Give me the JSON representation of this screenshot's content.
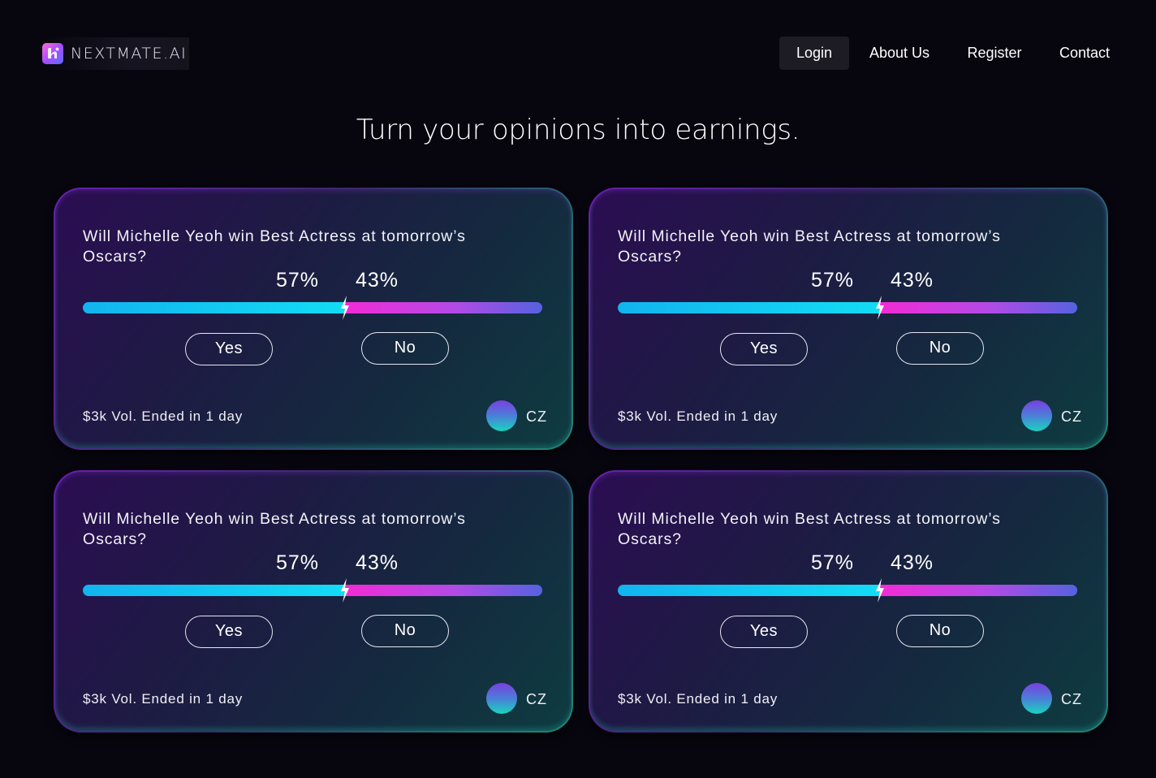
{
  "brand": {
    "name": "NEXTMATE.AI",
    "logo_icon": "nextmate-logo-icon"
  },
  "nav": {
    "login": "Login",
    "about": "About Us",
    "register": "Register",
    "contact": "Contact"
  },
  "headline": "Turn your opinions into earnings.",
  "colors": {
    "background": "#07060f",
    "yes_bar": "#13dcf4",
    "no_bar": "#f22bd6",
    "card_border_start": "#6a1fb0",
    "card_border_end": "#1c8a78"
  },
  "markets": [
    {
      "question": "Will Michelle Yeoh win Best Actress at tomorrow’s Oscars?",
      "yes_pct": 57,
      "no_pct": 43,
      "yes_label": "57%",
      "no_label": "43%",
      "yes_button": "Yes",
      "no_button": "No",
      "meta": "$3k Vol. Ended in 1 day",
      "creator": "CZ"
    },
    {
      "question": "Will Michelle Yeoh win Best Actress at tomorrow’s Oscars?",
      "yes_pct": 57,
      "no_pct": 43,
      "yes_label": "57%",
      "no_label": "43%",
      "yes_button": "Yes",
      "no_button": "No",
      "meta": "$3k Vol. Ended in 1 day",
      "creator": "CZ"
    },
    {
      "question": "Will Michelle Yeoh win Best Actress at tomorrow’s Oscars?",
      "yes_pct": 57,
      "no_pct": 43,
      "yes_label": "57%",
      "no_label": "43%",
      "yes_button": "Yes",
      "no_button": "No",
      "meta": "$3k Vol. Ended in 1 day",
      "creator": "CZ"
    },
    {
      "question": "Will Michelle Yeoh win Best Actress at tomorrow’s Oscars?",
      "yes_pct": 57,
      "no_pct": 43,
      "yes_label": "57%",
      "no_label": "43%",
      "yes_button": "Yes",
      "no_button": "No",
      "meta": "$3k Vol. Ended in 1 day",
      "creator": "CZ"
    }
  ]
}
